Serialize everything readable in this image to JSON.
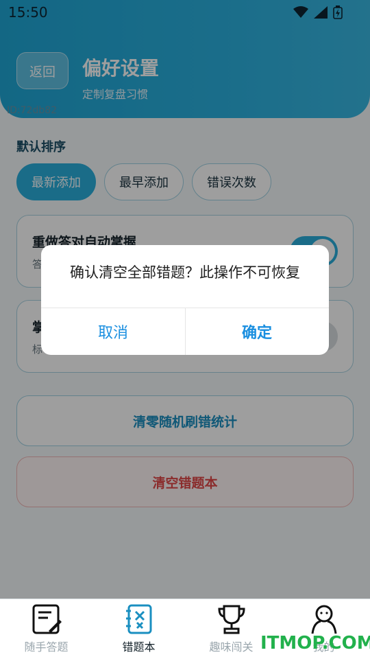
{
  "status_bar": {
    "time": "15:50"
  },
  "header": {
    "back_label": "返回",
    "title": "偏好设置",
    "subtitle": "定制复盘习惯",
    "id_text": "ID:72db82"
  },
  "sort": {
    "label": "默认排序",
    "options": [
      "最新添加",
      "最早添加",
      "错误次数"
    ],
    "selected": "最新添加"
  },
  "cards": [
    {
      "title": "重做答对自动掌握",
      "desc": "答",
      "toggle_on": true
    },
    {
      "title": "掌",
      "desc": "标",
      "toggle_on": false
    }
  ],
  "actions": {
    "reset_stats": "清零随机刷错统计",
    "clear_book": "清空错题本"
  },
  "dialog": {
    "message": "确认清空全部错题？此操作不可恢复",
    "cancel": "取消",
    "confirm": "确定"
  },
  "bottom_nav": [
    {
      "label": "随手答题",
      "icon": "note-edit-icon",
      "active": false
    },
    {
      "label": "错题本",
      "icon": "wrongbook-icon",
      "active": true
    },
    {
      "label": "趣味闯关",
      "icon": "trophy-icon",
      "active": false
    },
    {
      "label": "我的",
      "icon": "person-icon",
      "active": false
    }
  ],
  "watermark": "ITMOP.COM",
  "colors": {
    "accent": "#2aaedc",
    "danger": "#e04848",
    "dialog_button": "#1a8fe0"
  }
}
